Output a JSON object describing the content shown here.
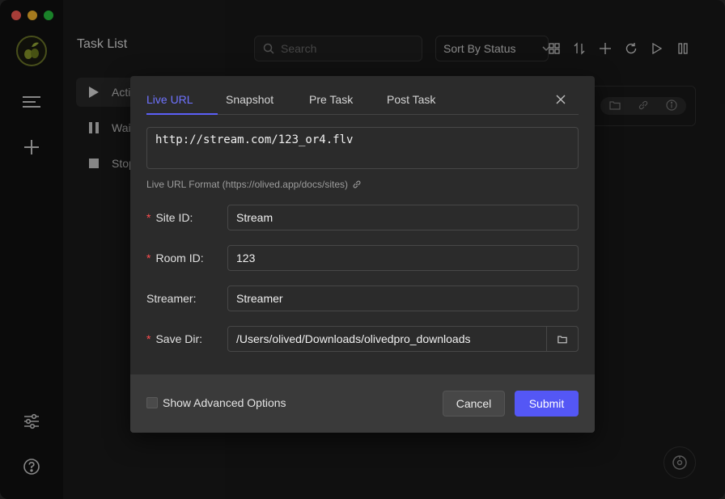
{
  "window": {
    "traffic_lights": [
      "close",
      "minimize",
      "zoom"
    ]
  },
  "rail": {
    "logo_icon": "olive-logo",
    "menu_icon": "hamburger-menu-icon",
    "add_icon": "plus-icon",
    "settings_icon": "sliders-icon",
    "help_icon": "question-circle-icon"
  },
  "task_list": {
    "title": "Task List",
    "items": [
      {
        "label": "Acti",
        "icon": "play-icon"
      },
      {
        "label": "Wai",
        "icon": "pause-icon"
      },
      {
        "label": "Stop",
        "icon": "stop-icon"
      }
    ]
  },
  "toolbar": {
    "search_placeholder": "Search",
    "sort_label": "Sort By Status"
  },
  "dialog": {
    "tabs": [
      {
        "label": "Live URL",
        "active": true
      },
      {
        "label": "Snapshot",
        "active": false
      },
      {
        "label": "Pre Task",
        "active": false
      },
      {
        "label": "Post Task",
        "active": false
      }
    ],
    "live_url": "http://stream.com/123_or4.flv",
    "hint": "Live URL Format (https://olived.app/docs/sites)",
    "fields": {
      "site_id": {
        "label": "Site ID:",
        "required": true,
        "value": "Stream"
      },
      "room_id": {
        "label": "Room ID:",
        "required": true,
        "value": "123"
      },
      "streamer": {
        "label": "Streamer:",
        "required": false,
        "value": "Streamer"
      },
      "save_dir": {
        "label": "Save Dir:",
        "required": true,
        "value": "/Users/olived/Downloads/olivedpro_downloads"
      }
    },
    "required_mark": "*",
    "advanced_label": "Show Advanced Options",
    "cancel_label": "Cancel",
    "submit_label": "Submit"
  },
  "colors": {
    "accent": "#5457f5",
    "tab_active": "#6f73ff",
    "required": "#ff4d4f"
  }
}
